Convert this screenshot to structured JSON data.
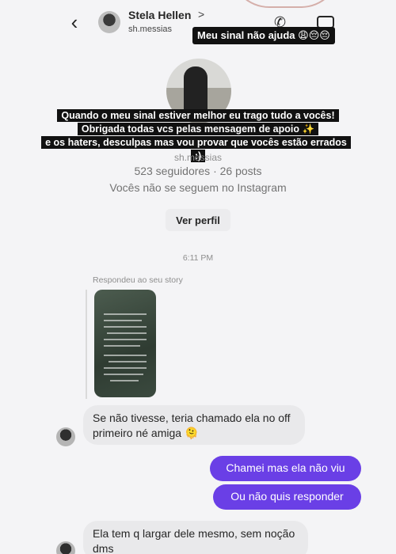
{
  "header": {
    "name": "Stela Hellen",
    "chevron": ">",
    "username": "sh.messias",
    "back_icon": "‹",
    "phone_icon": "✆"
  },
  "stickers": {
    "top": "Meu sinal não ajuda 😩😔😔",
    "caption_lines": [
      "Quando o meu sinal estiver melhor eu trago tudo a vocês!",
      "Obrigada todas vcs pelas mensagem de apoio ✨",
      "e os haters, desculpas mas vou provar que vocês estão errados :)"
    ]
  },
  "profile": {
    "username": "sh.messias",
    "stats": "523 seguidores · 26 posts",
    "follow_note": "Vocês não se seguem no Instagram",
    "view_profile_label": "Ver perfil"
  },
  "chat": {
    "timestamp": "6:11 PM",
    "replied_label": "Respondeu ao seu story",
    "messages": [
      {
        "from": "them",
        "text": "Se não tivesse, teria chamado ela no off primeiro né amiga 🫠"
      },
      {
        "from": "me",
        "text": "Chamei mas ela não viu"
      },
      {
        "from": "me",
        "text": "Ou não quis responder"
      },
      {
        "from": "them",
        "text": "Ela tem q largar dele mesmo, sem noção dms"
      }
    ]
  },
  "colors": {
    "outgoing_bubble": "#6a3fe6",
    "incoming_bubble": "#e9e9eb",
    "background": "#f4f4f6"
  }
}
